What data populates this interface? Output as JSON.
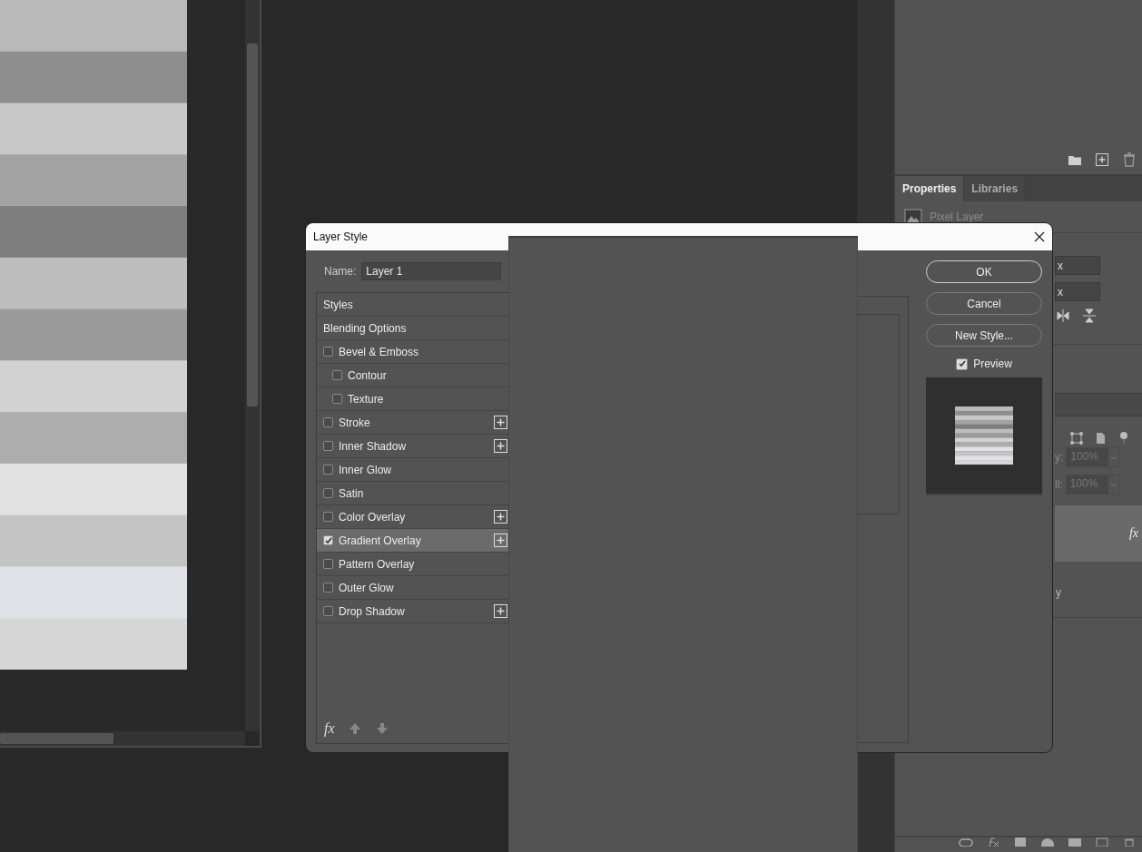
{
  "properties_panel": {
    "tabs": [
      {
        "label": "Properties",
        "selected": true
      },
      {
        "label": "Libraries",
        "selected": false
      }
    ],
    "layer_type": "Pixel Layer",
    "fields": [
      "x",
      "x"
    ]
  },
  "layers_panel": {
    "opacity_label": "y:",
    "opacity": "100%",
    "fill_label": "ll:",
    "fill": "100%",
    "layer_row": {
      "effects": "fx",
      "selected": true
    },
    "caption": "y"
  },
  "dialog": {
    "title": "Layer Style",
    "name_label": "Name:",
    "name_value": "Layer 1",
    "styles": [
      {
        "label": "Styles",
        "kind": "header",
        "selected": false
      },
      {
        "label": "Blending Options",
        "kind": "header",
        "selected": false
      },
      {
        "label": "Bevel & Emboss",
        "kind": "check",
        "checked": false,
        "selected": false,
        "addable": false,
        "children": [
          {
            "label": "Contour",
            "kind": "check",
            "checked": false,
            "selected": false,
            "addable": false
          },
          {
            "label": "Texture",
            "kind": "check",
            "checked": false,
            "selected": false,
            "addable": false
          }
        ]
      },
      {
        "label": "Stroke",
        "kind": "check",
        "checked": false,
        "selected": false,
        "addable": true
      },
      {
        "label": "Inner Shadow",
        "kind": "check",
        "checked": false,
        "selected": false,
        "addable": true
      },
      {
        "label": "Inner Glow",
        "kind": "check",
        "checked": false,
        "selected": false,
        "addable": false
      },
      {
        "label": "Satin",
        "kind": "check",
        "checked": false,
        "selected": false,
        "addable": false
      },
      {
        "label": "Color Overlay",
        "kind": "check",
        "checked": false,
        "selected": false,
        "addable": true
      },
      {
        "label": "Gradient Overlay",
        "kind": "check",
        "checked": true,
        "selected": true,
        "addable": true
      },
      {
        "label": "Pattern Overlay",
        "kind": "check",
        "checked": false,
        "selected": false,
        "addable": false
      },
      {
        "label": "Outer Glow",
        "kind": "check",
        "checked": false,
        "selected": false,
        "addable": false
      },
      {
        "label": "Drop Shadow",
        "kind": "check",
        "checked": false,
        "selected": false,
        "addable": true
      }
    ],
    "footer_effects": "fx",
    "buttons": [
      {
        "label": "OK",
        "default": true
      },
      {
        "label": "Cancel",
        "default": false
      },
      {
        "label": "New Style...",
        "default": false
      }
    ],
    "preview": {
      "label": "Preview",
      "checked": true
    }
  }
}
